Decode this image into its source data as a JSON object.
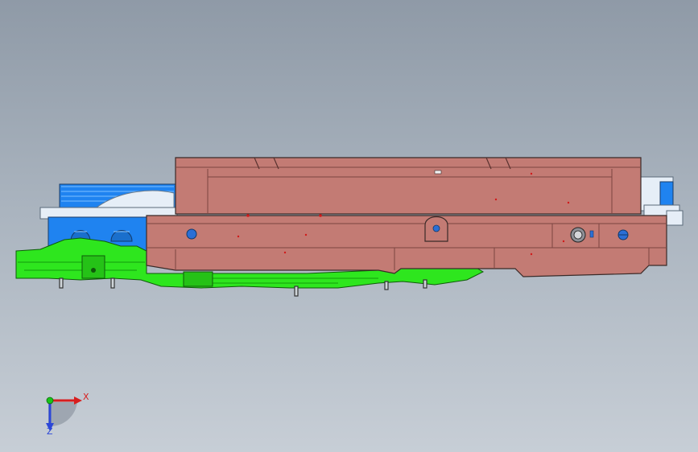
{
  "colors": {
    "background_top": "#8f9aa7",
    "background_bottom": "#c7ced6",
    "red_part": "#c37b74",
    "red_part_dark": "#a85c57",
    "green_part": "#2ee61e",
    "blue_part": "#1f83f0",
    "white_part": "#e6eef7",
    "edge": "#3a2a28",
    "hole_blue": "#2b6fd6",
    "axis_x": "#d81e1e",
    "axis_y": "#19c419",
    "axis_z": "#2c47d8"
  },
  "triad": {
    "x_label": "X",
    "z_label": "Z"
  }
}
